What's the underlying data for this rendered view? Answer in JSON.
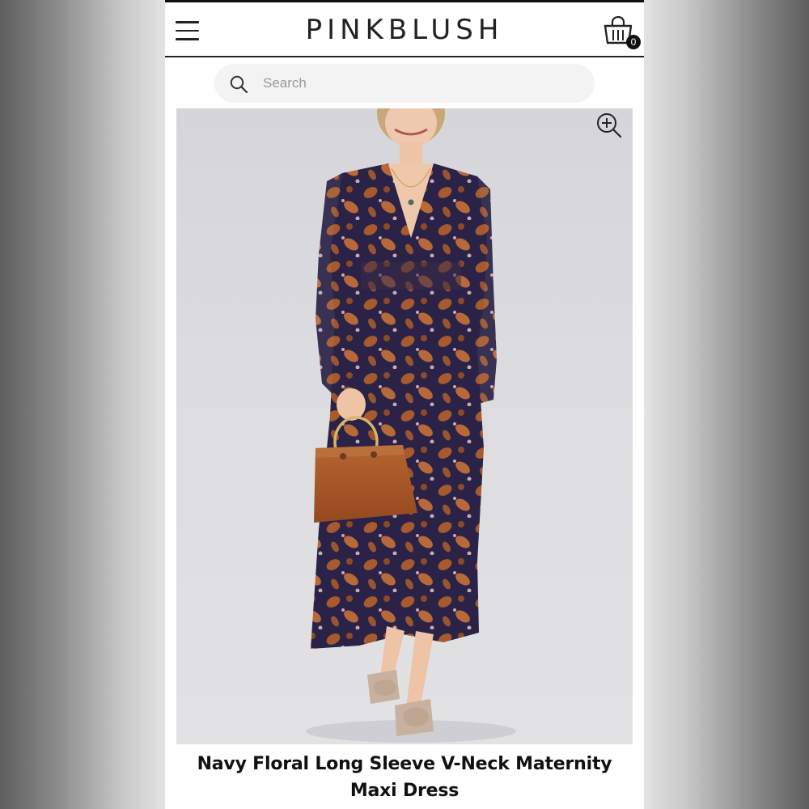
{
  "header": {
    "brand": "PINKBLUSH",
    "cart_count": "0"
  },
  "search": {
    "placeholder": "Search"
  },
  "product": {
    "title": "Navy Floral Long Sleeve V-Neck Maternity Maxi Dress",
    "image_alt": "Model wearing navy floral long sleeve v-neck maxi dress holding a tan handbag"
  },
  "colors": {
    "dress_base": "#2a2247",
    "dress_floral": "#a65a2e",
    "bag": "#a8592a",
    "background": "#dcdce0"
  },
  "icons": {
    "menu": "hamburger-icon",
    "cart": "shopping-basket-icon",
    "search": "magnifier-icon",
    "zoom": "zoom-in-icon"
  }
}
